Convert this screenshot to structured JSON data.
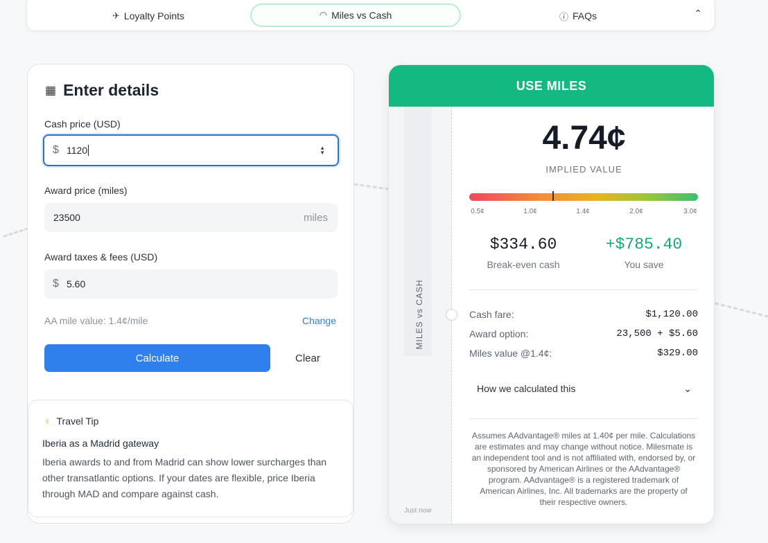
{
  "tabs": [
    {
      "label": "Loyalty Points",
      "icon": "plane-icon"
    },
    {
      "label": "Miles vs Cash",
      "icon": "gauge-icon",
      "active": true
    },
    {
      "label": "FAQs",
      "icon": "help-circle-icon"
    }
  ],
  "form": {
    "title": "Enter details",
    "cash_label": "Cash price (USD)",
    "cash_prefix": "$",
    "cash_value": "1120",
    "award_label": "Award price (miles)",
    "award_value": "23500",
    "award_suffix": "miles",
    "taxes_label": "Award taxes & fees (USD)",
    "taxes_prefix": "$",
    "taxes_value": "5.60",
    "mile_value_text": "AA mile value: 1.4¢/mile",
    "change_label": "Change",
    "calculate_label": "Calculate",
    "clear_label": "Clear"
  },
  "tip": {
    "heading": "Travel Tip",
    "subheading": "Iberia as a Madrid gateway",
    "body": "Iberia awards to and from Madrid can show lower surcharges than other transatlantic options. If your dates are flexible, price Iberia through MAD and compare against cash."
  },
  "result": {
    "banner": "USE MILES",
    "stub_label": "MILES vs CASH",
    "stub_time": "Just now",
    "implied_value": "4.74¢",
    "implied_label": "IMPLIED VALUE",
    "scale_ticks": [
      "0.5¢",
      "1.0¢",
      "1.4¢",
      "2.0¢",
      "3.0¢"
    ],
    "scale_marker_position": 0.365,
    "breakeven_amount": "$334.60",
    "breakeven_label": "Break-even cash",
    "save_amount": "+$785.40",
    "save_label": "You save",
    "rows": [
      {
        "label": "Cash fare:",
        "value": "$1,120.00"
      },
      {
        "label": "Award option:",
        "value": "23,500 + $5.60"
      },
      {
        "label": "Miles value @1.4¢:",
        "value": "$329.00"
      }
    ],
    "how_calc_label": "How we calculated this",
    "disclaimer": "Assumes AAdvantage® miles at 1.40¢ per mile. Calculations are estimates and may change without notice. Milesmate is an independent tool and is not affiliated with, endorsed by, or sponsored by American Airlines or the AAdvantage® program. AAdvantage® is a registered trademark of American Airlines, Inc. All trademarks are the property of their respective owners."
  },
  "colors": {
    "accent_green": "#13b981",
    "primary_blue": "#2f80ed",
    "save_green": "#12a873"
  }
}
